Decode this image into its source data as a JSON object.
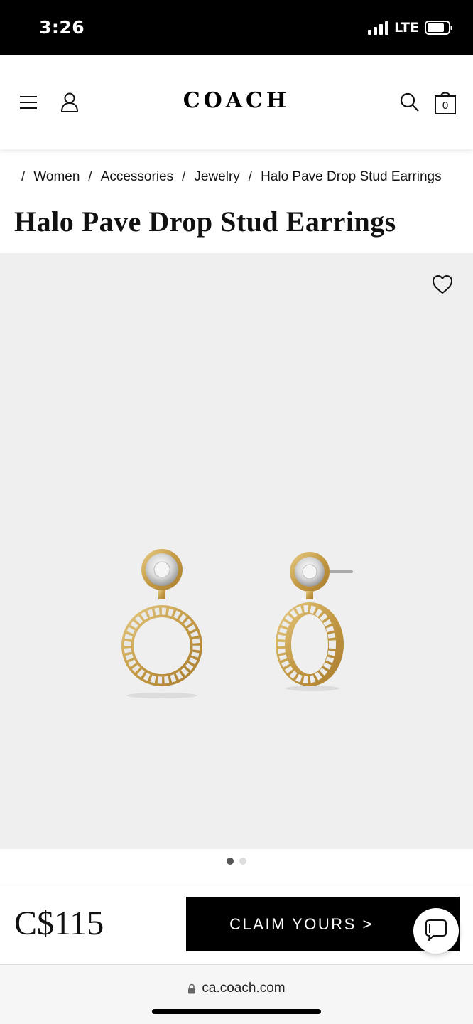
{
  "status_bar": {
    "time": "3:26",
    "network": "LTE"
  },
  "header": {
    "logo": "COACH",
    "cart_count": "0",
    "icons": [
      "menu-icon",
      "account-icon",
      "search-icon",
      "shopping-bag-icon"
    ]
  },
  "breadcrumb": {
    "items": [
      "Women",
      "Accessories",
      "Jewelry",
      "Halo Pave Drop Stud Earrings"
    ]
  },
  "product": {
    "title": "Halo Pave Drop Stud Earrings",
    "price": "C$115",
    "image_count": 2,
    "active_image": 1
  },
  "actions": {
    "claim_label": "CLAIM YOURS >"
  },
  "browser": {
    "url": "ca.coach.com"
  },
  "colors": {
    "status_bar_bg": "#000000",
    "image_bg": "#efefef",
    "button_bg": "#000000",
    "gold": "#c9a24a"
  }
}
